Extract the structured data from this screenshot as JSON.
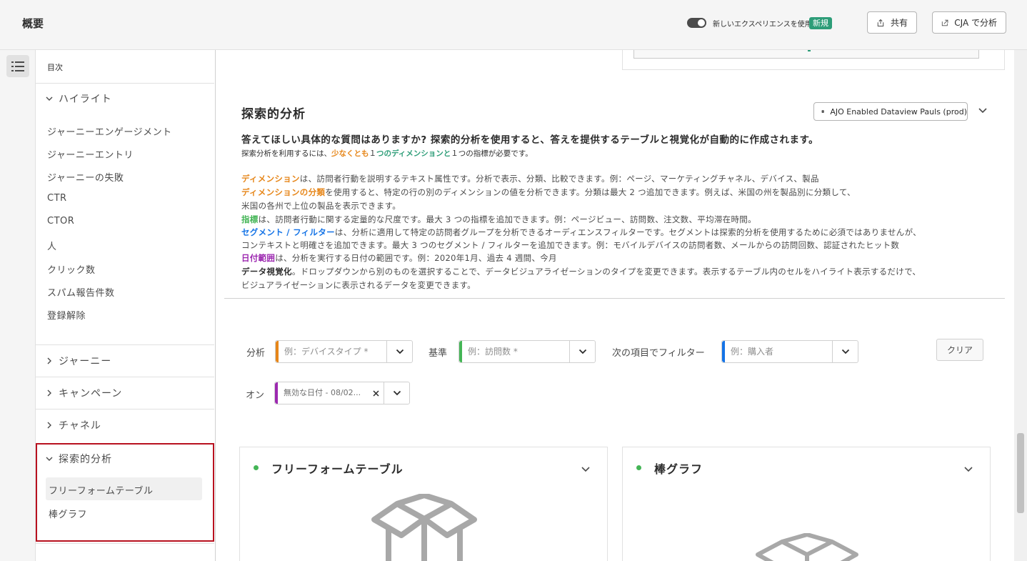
{
  "header": {
    "title": "概要",
    "toggle_label": "新しいエクスペリエンスを使用",
    "badge": "新規",
    "share_label": "共有",
    "cja_label": "CJA で分析"
  },
  "sidebar": {
    "toc_title": "目次",
    "highlights_label": "ハイライト",
    "highlight_items": [
      "ジャーニーエンゲージメント",
      "ジャーニーエントリ",
      "ジャーニーの失敗",
      "CTR",
      "CTOR",
      "人",
      "クリック数",
      "スパム報告件数",
      "登録解除"
    ],
    "sections": [
      "ジャーニー",
      "キャンペーン",
      "チャネル"
    ],
    "exploratory_label": "探索的分析",
    "exploratory_items": [
      "フリーフォームテーブル",
      "棒グラフ"
    ]
  },
  "exploratory": {
    "title": "探索的分析",
    "dataview": "AJO Enabled Dataview Pauls (prod)",
    "question": "答えてほしい具体的な質問はありますか? 探索的分析を使用すると、答えを提供するテーブルと視覚化が自動的に作成されます。",
    "req_prefix": "探索分析を利用するには、",
    "req_orange": "少なくとも",
    "req_mid": "１",
    "req_green": "つのディメンションと",
    "req_suffix": "１つの指標が必要です。",
    "dim_term": "ディメンション",
    "dim_text": "は、訪問者行動を説明するテキスト属性です。分析で表示、分類、比較できます。例：ページ、マーケティングチャネル、デバイス、製品",
    "breakdown_term": "ディメンションの分類",
    "breakdown_text": "を使用すると、特定の行の別のディメンションの値を分析できます。分類は最大 2 つ追加できます。例えば、米国の州を製品別に分類して、",
    "breakdown_text2": "米国の各州で上位の製品を表示できます。",
    "metric_term": "指標",
    "metric_text": "は、訪問者行動に関する定量的な尺度です。最大 3 つの指標を追加できます。例：ページビュー、訪問数、注文数、平均滞在時間。",
    "segment_term": "セグメント / フィルター",
    "segment_text": "は、分析に適用して特定の訪問者グループを分析できるオーディエンスフィルターです。セグメントは探索的分析を使用するために必須ではありませんが、",
    "segment_text2": "コンテキストと明確さを追加できます。最大 3 つのセグメント / フィルターを追加できます。例：モバイルデバイスの訪問者数、メールからの訪問回数、認証されたヒット数",
    "date_term": "日付範囲",
    "date_text": "は、分析を実行する日付の範囲です。例：2020年1月、過去 4 週間、今月",
    "viz_term": "データ視覚化",
    "viz_text": "。ドロップダウンから別のものを選択することで、データビジュアライゼーションのタイプを変更できます。表示するテーブル内のセルをハイライト表示するだけで、",
    "viz_text2": "ビジュアライゼーションに表示されるデータを変更できます。"
  },
  "filters": {
    "analyze_label": "分析",
    "analyze_placeholder": "例：デバイスタイプ *",
    "metric_label": "基準",
    "metric_placeholder": "例：訪問数 *",
    "filter_label": "次の項目でフィルター",
    "filter_placeholder": "例：購入者",
    "clear_label": "クリア",
    "on_label": "オン",
    "date_value": "無効な日付 - 08/02...",
    "colors": {
      "analyze": "#e68619",
      "metric": "#44b556",
      "filter": "#1473e6",
      "date": "#9c28b0"
    }
  },
  "cards": [
    {
      "title": "フリーフォームテーブル"
    },
    {
      "title": "棒グラフ"
    }
  ]
}
